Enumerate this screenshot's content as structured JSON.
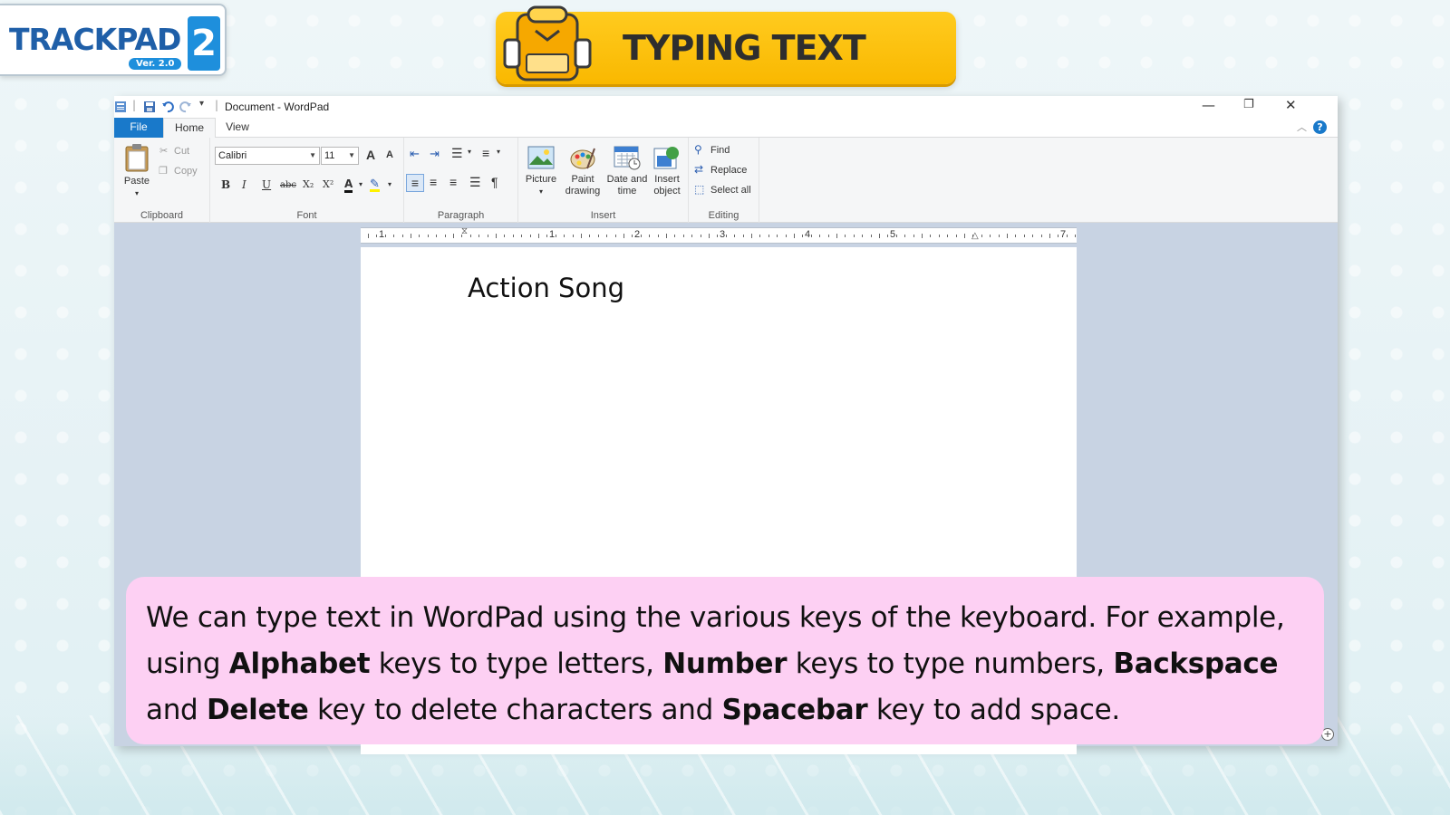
{
  "branding": {
    "logo_text": "TRACKPAD",
    "logo_number": "2",
    "logo_version": "Ver. 2.0",
    "banner_title": "TYPING TEXT",
    "banner_color": "#fbbf0a"
  },
  "window": {
    "title": "Document - WordPad",
    "controls": {
      "minimize": "—",
      "restore": "❐",
      "close": "✕"
    },
    "tabs": [
      "File",
      "Home",
      "View"
    ],
    "accent_color": "#1979ca"
  },
  "ribbon": {
    "clipboard": {
      "label": "Clipboard",
      "paste": "Paste",
      "cut": "Cut",
      "copy": "Copy"
    },
    "font": {
      "label": "Font",
      "family": "Calibri",
      "size": "11",
      "grow": "A",
      "shrink": "A",
      "bold": "B",
      "italic": "I",
      "underline": "U",
      "strikethrough": "abc",
      "subscript": "X₂",
      "superscript": "X²",
      "color": "A"
    },
    "paragraph": {
      "label": "Paragraph"
    },
    "insert": {
      "label": "Insert",
      "picture": "Picture",
      "paint_line1": "Paint",
      "paint_line2": "drawing",
      "datetime_line1": "Date and",
      "datetime_line2": "time",
      "object_line1": "Insert",
      "object_line2": "object"
    },
    "editing": {
      "label": "Editing",
      "find": "Find",
      "replace": "Replace",
      "select_all": "Select all"
    }
  },
  "ruler": {
    "numbers": [
      "1",
      "1",
      "2",
      "3",
      "4",
      "5",
      "7"
    ]
  },
  "document": {
    "text": "Action Song"
  },
  "caption": {
    "part1": "We can type text in WordPad using the various keys of the keyboard. For example, using ",
    "bold1": "Alphabet",
    "part2": " keys to type letters, ",
    "bold2": "Number",
    "part3": " keys to type numbers, ",
    "bold3": "Backspace",
    "part4": " and ",
    "bold4": "Delete",
    "part5": " key to delete characters and ",
    "bold5": "Spacebar",
    "part6": " key to add space.",
    "background_color": "#fdd0f3"
  }
}
